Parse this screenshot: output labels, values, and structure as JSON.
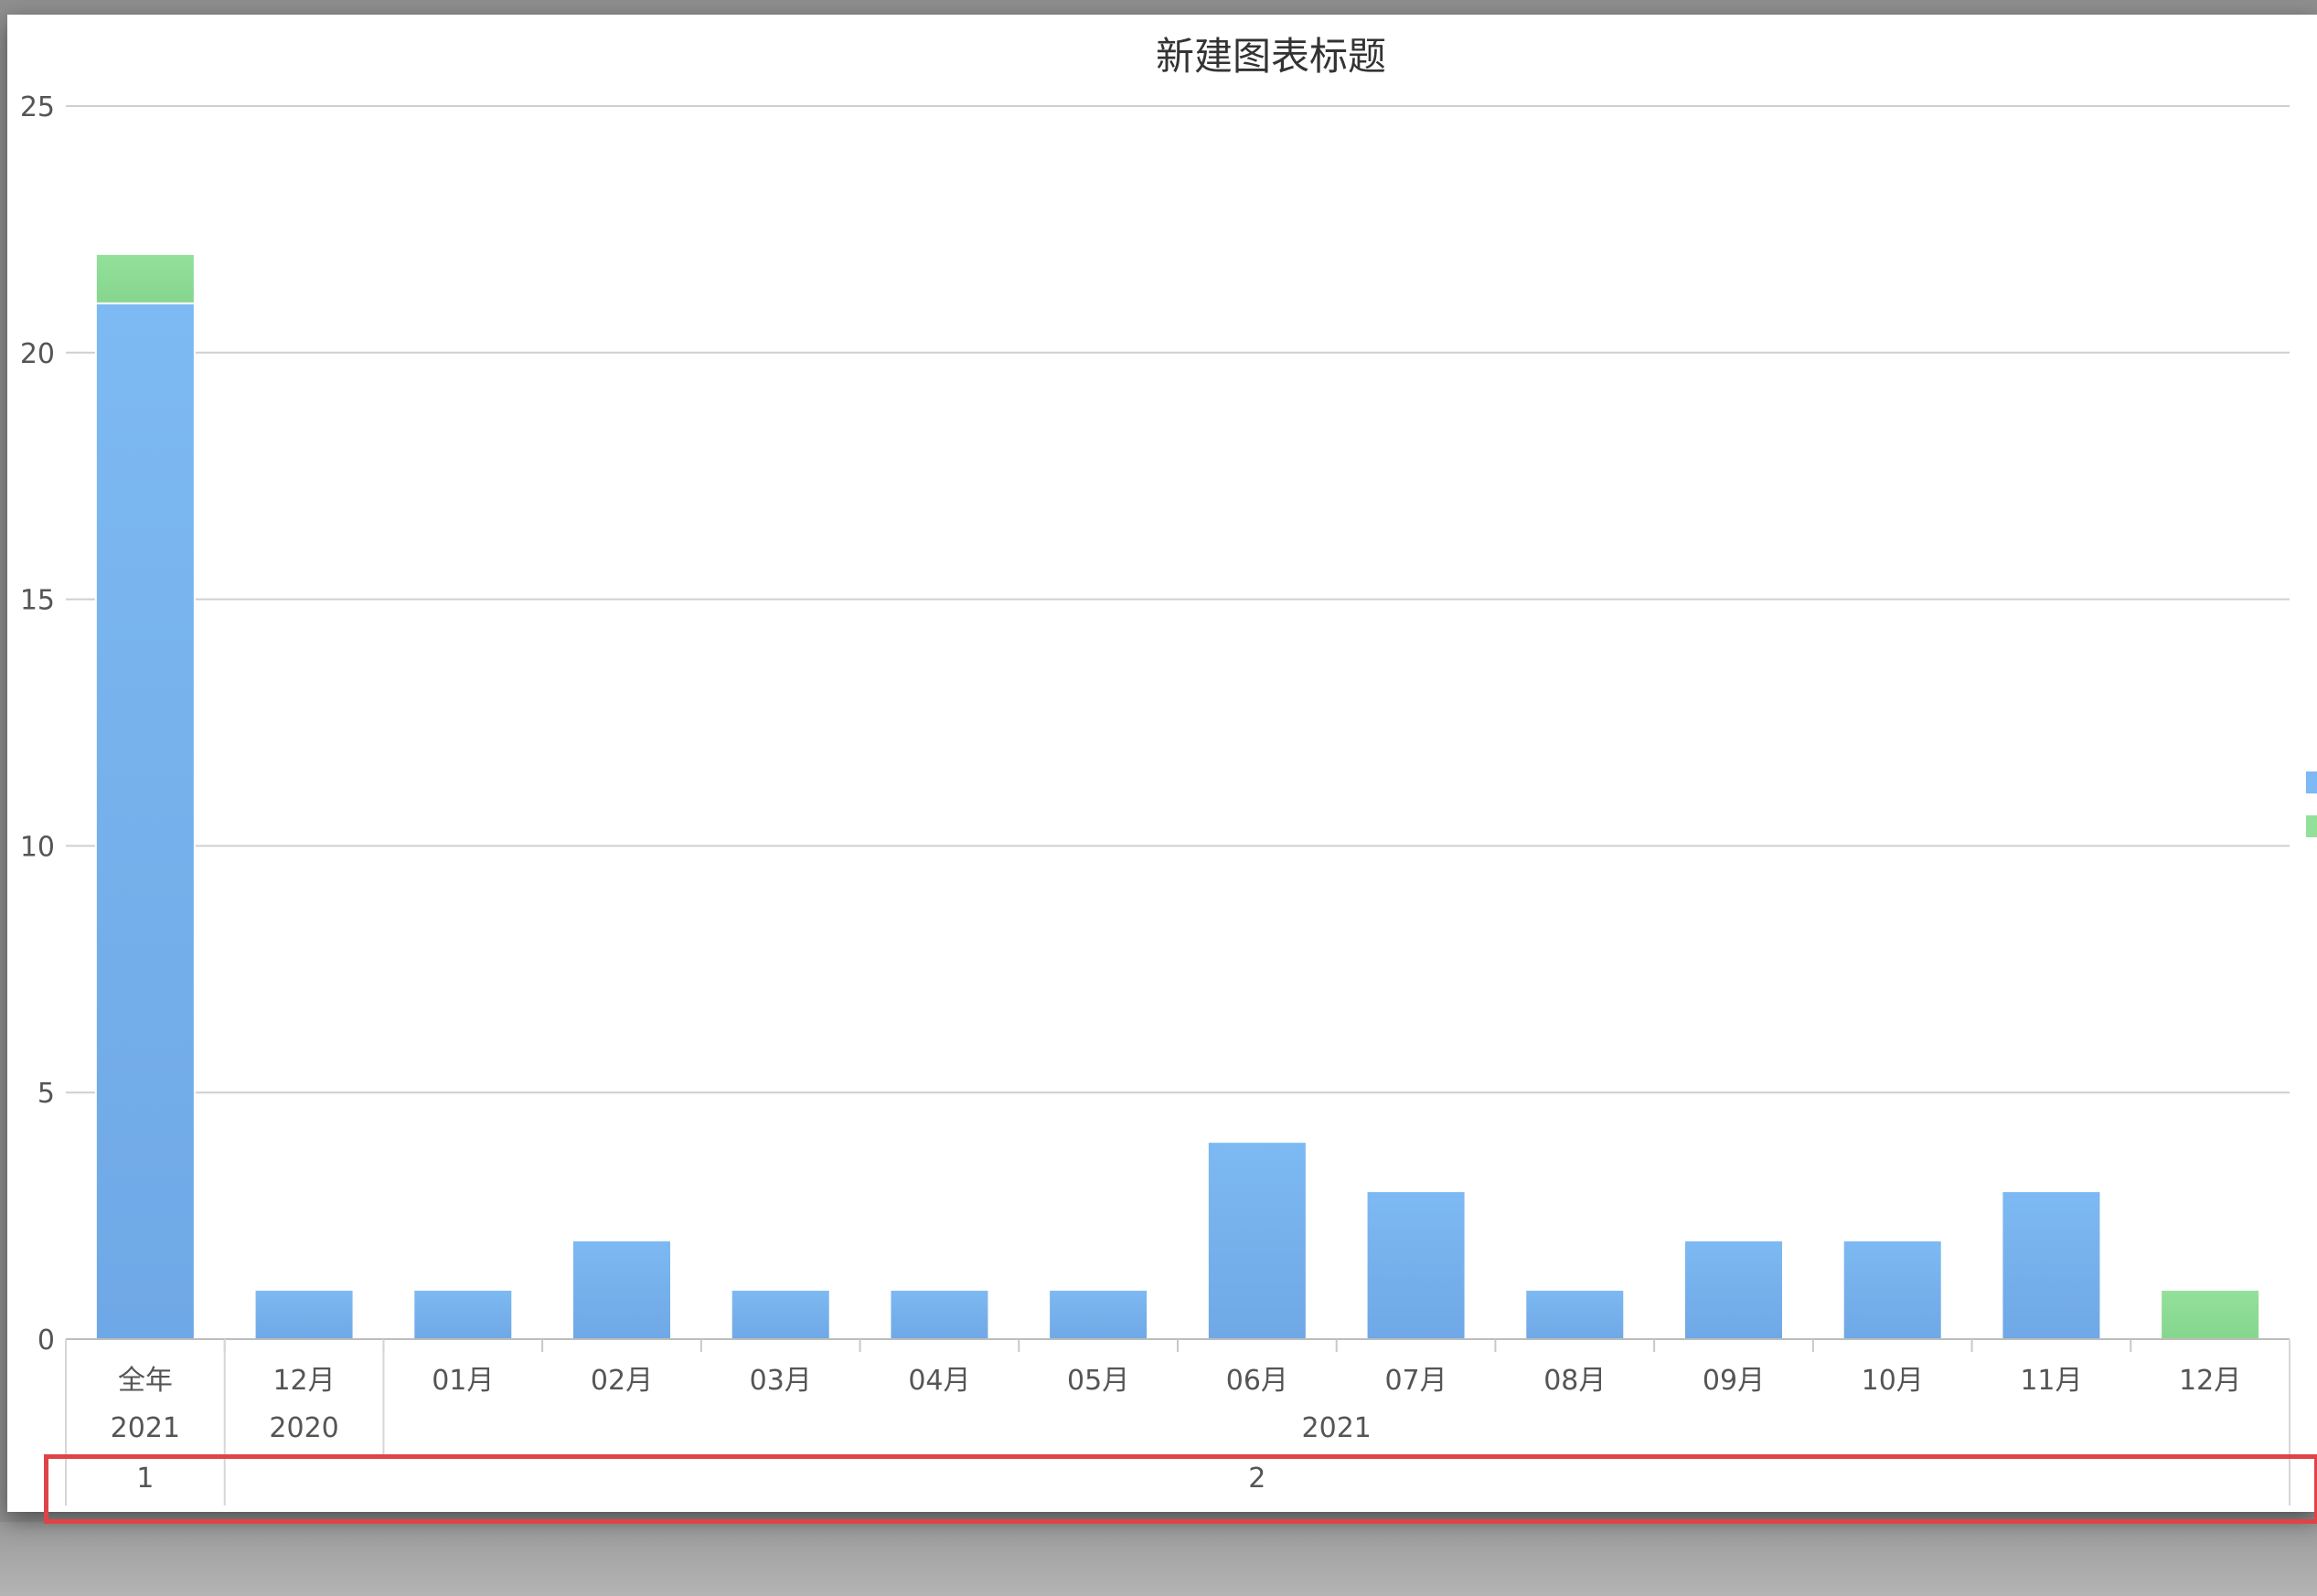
{
  "chart_data": {
    "type": "bar",
    "stacked": true,
    "title": "新建图表标题",
    "xlabel": "",
    "ylabel": "",
    "ylim": [
      0,
      25
    ],
    "yticks": [
      0,
      5,
      10,
      15,
      20,
      25
    ],
    "grid": true,
    "categories": [
      "全年",
      "12月",
      "01月",
      "02月",
      "03月",
      "04月",
      "05月",
      "06月",
      "07月",
      "08月",
      "09月",
      "10月",
      "11月",
      "12月"
    ],
    "category_groups": [
      [
        {
          "label": "2021",
          "span": 1
        },
        {
          "label": "2020",
          "span": 1
        },
        {
          "label": "2021",
          "span": 12
        }
      ],
      [
        {
          "label": "1",
          "span": 1
        },
        {
          "label": "2",
          "span": 13
        }
      ]
    ],
    "series": [
      {
        "color": "#7db9f2",
        "values": [
          21,
          1,
          1,
          2,
          1,
          1,
          1,
          4,
          3,
          1,
          2,
          2,
          3,
          0
        ]
      },
      {
        "color": "#93e09a",
        "values": [
          1,
          0,
          0,
          0,
          0,
          0,
          0,
          0,
          0,
          0,
          0,
          0,
          0,
          1
        ]
      }
    ],
    "legend": "right",
    "highlighted_row": "2"
  },
  "colors": {
    "series_1": "#7db9f2",
    "series_2": "#93e09a",
    "highlight_border": "#e04345",
    "grid": "#cfcfcf"
  }
}
